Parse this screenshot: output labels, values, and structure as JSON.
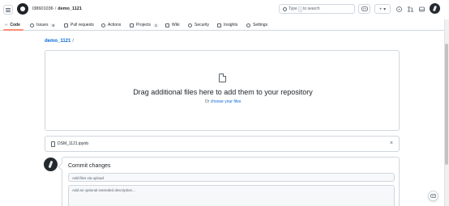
{
  "header": {
    "owner": "l38601036",
    "separator": "/",
    "repo": "demo_1121",
    "search_prefix": "Type",
    "search_key": "/",
    "search_suffix": "to search",
    "plus_label": "+ ▾"
  },
  "tabs": [
    {
      "label": "Code"
    },
    {
      "label": "Issues",
      "count": "9"
    },
    {
      "label": "Pull requests"
    },
    {
      "label": "Actions"
    },
    {
      "label": "Projects",
      "count": "1"
    },
    {
      "label": "Wiki"
    },
    {
      "label": "Security"
    },
    {
      "label": "Insights"
    },
    {
      "label": "Settings"
    }
  ],
  "breadcrumb": {
    "repo": "demo_1121",
    "slash": "/"
  },
  "dropzone": {
    "title": "Drag additional files here to add them to your repository",
    "sub_prefix": "Or",
    "sub_link": "choose your files"
  },
  "uploaded_file": {
    "name": "DSM_1121.ipynb",
    "close": "×"
  },
  "commit": {
    "title": "Commit changes",
    "summary_placeholder": "Add files via upload",
    "description_placeholder": "Add an optional extended description..."
  }
}
